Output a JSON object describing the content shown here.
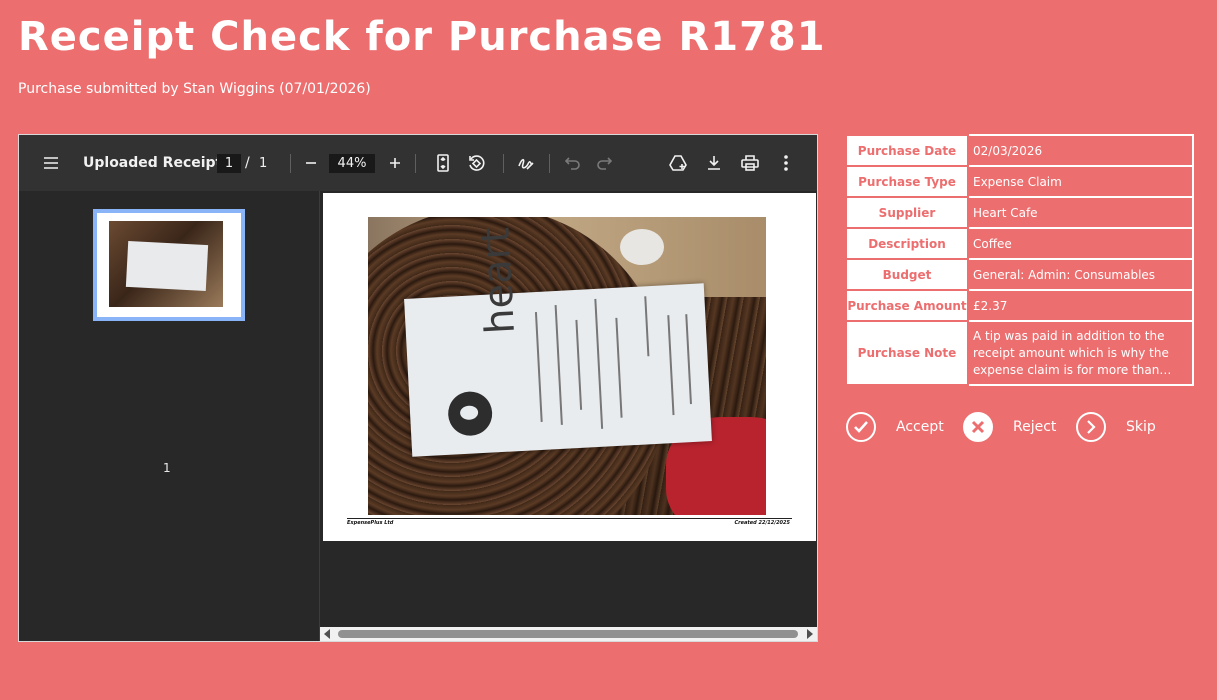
{
  "header": {
    "title": "Receipt Check for Purchase R1781",
    "subtitle": "Purchase submitted by Stan Wiggins (07/01/2026)"
  },
  "viewer": {
    "doc_title": "Uploaded Receipt",
    "page_current": "1",
    "page_separator": "/",
    "page_total": "1",
    "zoom": "44%",
    "thumbnail_label": "1",
    "footer_left": "ExpensePlus Ltd",
    "footer_right": "Created 22/12/2025",
    "receipt_logo_text": "heart"
  },
  "details": {
    "rows": [
      {
        "label": "Purchase Date",
        "value": "02/03/2026"
      },
      {
        "label": "Purchase Type",
        "value": "Expense Claim"
      },
      {
        "label": "Supplier",
        "value": "Heart Cafe"
      },
      {
        "label": "Description",
        "value": "Coffee"
      },
      {
        "label": "Budget",
        "value": "General: Admin: Consumables"
      },
      {
        "label": "Purchase Amount",
        "value": "£2.37"
      },
      {
        "label": "Purchase Note",
        "value": "A tip was paid in addition to the receipt amount which is why the expense claim is for more than the..."
      }
    ]
  },
  "actions": {
    "accept": "Accept",
    "reject": "Reject",
    "skip": "Skip"
  },
  "colors": {
    "background": "#ec6e6f",
    "viewer_toolbar": "#323232",
    "viewer_body": "#282828",
    "thumb_selected": "#8ab4f8"
  }
}
